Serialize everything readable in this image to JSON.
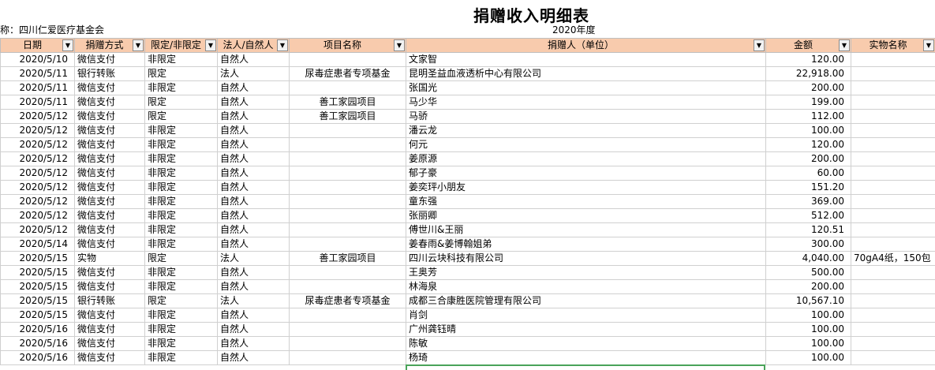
{
  "title": "捐赠收入明细表",
  "org_line": "称：四川仁爱医疗基金会",
  "year_line": "2020年度",
  "columns": [
    "日期",
    "捐赠方式",
    "限定/非限定",
    "法人/自然人",
    "项目名称",
    "捐赠人（单位）",
    "金额",
    "实物名称"
  ],
  "rows": [
    {
      "date": "2020/5/10",
      "method": "微信支付",
      "restrict": "非限定",
      "type": "自然人",
      "project": "",
      "donor": "文家智",
      "amount": "120.00",
      "item": ""
    },
    {
      "date": "2020/5/11",
      "method": "银行转账",
      "restrict": "限定",
      "type": "法人",
      "project": "尿毒症患者专项基金",
      "donor": "昆明圣益血液透析中心有限公司",
      "amount": "22,918.00",
      "item": ""
    },
    {
      "date": "2020/5/11",
      "method": "微信支付",
      "restrict": "非限定",
      "type": "自然人",
      "project": "",
      "donor": "张国光",
      "amount": "200.00",
      "item": ""
    },
    {
      "date": "2020/5/11",
      "method": "微信支付",
      "restrict": "限定",
      "type": "自然人",
      "project": "善工家园项目",
      "donor": "马少华",
      "amount": "199.00",
      "item": ""
    },
    {
      "date": "2020/5/12",
      "method": "微信支付",
      "restrict": "限定",
      "type": "自然人",
      "project": "善工家园项目",
      "donor": "马骄",
      "amount": "112.00",
      "item": ""
    },
    {
      "date": "2020/5/12",
      "method": "微信支付",
      "restrict": "非限定",
      "type": "自然人",
      "project": "",
      "donor": "潘云龙",
      "amount": "100.00",
      "item": ""
    },
    {
      "date": "2020/5/12",
      "method": "微信支付",
      "restrict": "非限定",
      "type": "自然人",
      "project": "",
      "donor": "何元",
      "amount": "120.00",
      "item": ""
    },
    {
      "date": "2020/5/12",
      "method": "微信支付",
      "restrict": "非限定",
      "type": "自然人",
      "project": "",
      "donor": "姜原源",
      "amount": "200.00",
      "item": ""
    },
    {
      "date": "2020/5/12",
      "method": "微信支付",
      "restrict": "非限定",
      "type": "自然人",
      "project": "",
      "donor": "郁子豪",
      "amount": "60.00",
      "item": ""
    },
    {
      "date": "2020/5/12",
      "method": "微信支付",
      "restrict": "非限定",
      "type": "自然人",
      "project": "",
      "donor": "姜奕玶小朋友",
      "amount": "151.20",
      "item": ""
    },
    {
      "date": "2020/5/12",
      "method": "微信支付",
      "restrict": "非限定",
      "type": "自然人",
      "project": "",
      "donor": "童东强",
      "amount": "369.00",
      "item": ""
    },
    {
      "date": "2020/5/12",
      "method": "微信支付",
      "restrict": "非限定",
      "type": "自然人",
      "project": "",
      "donor": "张丽卿",
      "amount": "512.00",
      "item": ""
    },
    {
      "date": "2020/5/12",
      "method": "微信支付",
      "restrict": "非限定",
      "type": "自然人",
      "project": "",
      "donor": "傅世川&王丽",
      "amount": "120.51",
      "item": ""
    },
    {
      "date": "2020/5/14",
      "method": "微信支付",
      "restrict": "非限定",
      "type": "自然人",
      "project": "",
      "donor": "姜春雨&姜博翰姐弟",
      "amount": "300.00",
      "item": ""
    },
    {
      "date": "2020/5/15",
      "method": "实物",
      "restrict": "限定",
      "type": "法人",
      "project": "善工家园项目",
      "donor": "四川云块科技有限公司",
      "amount": "4,040.00",
      "item": "70gA4纸，150包"
    },
    {
      "date": "2020/5/15",
      "method": "微信支付",
      "restrict": "非限定",
      "type": "自然人",
      "project": "",
      "donor": "王奥芳",
      "amount": "500.00",
      "item": ""
    },
    {
      "date": "2020/5/15",
      "method": "微信支付",
      "restrict": "非限定",
      "type": "自然人",
      "project": "",
      "donor": "林海泉",
      "amount": "200.00",
      "item": ""
    },
    {
      "date": "2020/5/15",
      "method": "银行转账",
      "restrict": "限定",
      "type": "法人",
      "project": "尿毒症患者专项基金",
      "donor": "成都三合康胜医院管理有限公司",
      "amount": "10,567.10",
      "item": ""
    },
    {
      "date": "2020/5/15",
      "method": "微信支付",
      "restrict": "非限定",
      "type": "自然人",
      "project": "",
      "donor": "肖剑",
      "amount": "100.00",
      "item": ""
    },
    {
      "date": "2020/5/16",
      "method": "微信支付",
      "restrict": "非限定",
      "type": "自然人",
      "project": "",
      "donor": "广州龚钰晴",
      "amount": "100.00",
      "item": ""
    },
    {
      "date": "2020/5/16",
      "method": "微信支付",
      "restrict": "非限定",
      "type": "自然人",
      "project": "",
      "donor": "陈敏",
      "amount": "100.00",
      "item": ""
    },
    {
      "date": "2020/5/16",
      "method": "微信支付",
      "restrict": "非限定",
      "type": "自然人",
      "project": "",
      "donor": "杨琦",
      "amount": "100.00",
      "item": ""
    }
  ],
  "filter_icon": "filter-dropdown-icon",
  "colors": {
    "header_bg": "#f8cbad",
    "grid": "#d0d0d0",
    "selection": "#4aa35a"
  }
}
